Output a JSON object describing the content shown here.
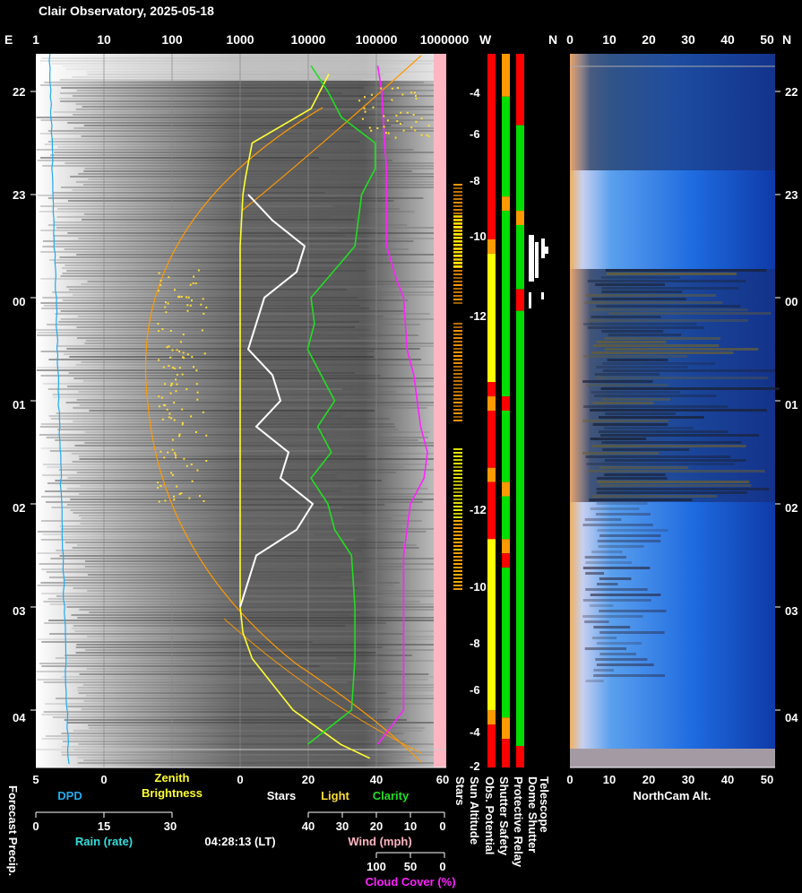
{
  "title": "Clair Observatory, 2025-05-18",
  "timestamp": "04:28:13 (LT)",
  "colors": {
    "sky": "#1e6be0",
    "dpd": "#22aaee",
    "rain": "#33dddd",
    "zenith": "#ffff33",
    "stars": "#ffffff",
    "light": "#ffdd33",
    "clarity": "#22dd22",
    "wind": "#ffb6c1",
    "cloud": "#ff22ff",
    "sun": "#ff9900",
    "status_green": "#00dd00",
    "status_red": "#ff0000",
    "status_orange": "#ff9900",
    "status_yellow": "#ffff00"
  },
  "top_axis": {
    "left_letter": "E",
    "ticks": [
      "1",
      "10",
      "100",
      "1000",
      "10000",
      "100000",
      "1000000"
    ],
    "w_label": "W",
    "n_label": "N",
    "cam_ticks": [
      "0",
      "10",
      "20",
      "30",
      "40",
      "50"
    ],
    "right_letter": "N"
  },
  "time_axis": {
    "left_ticks": [
      "22",
      "23",
      "00",
      "01",
      "02",
      "03",
      "04"
    ],
    "right_ticks": [
      "22",
      "23",
      "00",
      "01",
      "02",
      "03",
      "04"
    ]
  },
  "sun_altitude": {
    "upper_ticks": [
      "-4",
      "-6",
      "-8",
      "-10",
      "-12"
    ],
    "lower_ticks": [
      "-12",
      "-10",
      "-8",
      "-6",
      "-4",
      "-2"
    ]
  },
  "bottom_axes": {
    "dpd_ticks": [
      "5",
      "0"
    ],
    "zenith_label_1": "Zenith",
    "zenith_label_2": "Brightness",
    "main_ticks": [
      "0",
      "20",
      "40",
      "60"
    ],
    "dpd_label": "DPD",
    "stars_label": "Stars",
    "light_label": "Light",
    "clarity_label": "Clarity",
    "rain_ticks": [
      "0",
      "15",
      "30"
    ],
    "rain_label": "Rain (rate)",
    "wind_ticks": [
      "40",
      "30",
      "20",
      "10",
      "0"
    ],
    "wind_label": "Wind (mph)",
    "cloud_ticks": [
      "100",
      "50",
      "0"
    ],
    "cloud_label": "Cloud Cover (%)",
    "cam_ticks": [
      "0",
      "10",
      "20",
      "30",
      "40",
      "50"
    ],
    "cam_label": "NorthCam Alt."
  },
  "vertical_labels": {
    "forecast": "Forecast Precip.",
    "stars": "Stars",
    "sun_altitude": "Sun Altitude",
    "obs_potential": "Obs. Potential",
    "shutter_safety": "Shutter Safety",
    "protective_relay": "Protective Relay",
    "dome_shutter": "Dome Shutter",
    "telescope": "Telescope"
  },
  "chart_data": {
    "type": "line",
    "time_range": [
      "21:45",
      "04:28"
    ],
    "series": [
      {
        "name": "Zenith Brightness",
        "x": [
          "21:50",
          "22:10",
          "22:30",
          "22:50",
          "23:00",
          "23:30",
          "00:00",
          "00:30",
          "01:00",
          "01:30",
          "02:00",
          "02:30",
          "02:50",
          "03:00",
          "03:15",
          "03:30",
          "04:00",
          "04:20",
          "04:28"
        ],
        "values": [
          20000,
          11000,
          1500,
          1200,
          1100,
          1000,
          1000,
          1000,
          1000,
          1000,
          1000,
          1000,
          1000,
          1000,
          1100,
          1500,
          6000,
          30000,
          80000
        ]
      },
      {
        "name": "Stars",
        "x": [
          "23:00",
          "23:15",
          "23:30",
          "23:45",
          "00:00",
          "00:15",
          "00:30",
          "00:45",
          "01:00",
          "01:15",
          "01:30",
          "01:45",
          "02:00",
          "02:15",
          "02:30",
          "02:45",
          "03:00"
        ],
        "values": [
          1,
          4,
          8,
          7,
          3,
          2,
          1,
          4,
          5,
          2,
          6,
          5,
          9,
          7,
          2,
          1,
          0
        ]
      },
      {
        "name": "Clarity",
        "x": [
          "21:45",
          "22:00",
          "22:15",
          "22:30",
          "22:45",
          "23:00",
          "23:30",
          "00:00",
          "00:15",
          "00:30",
          "00:45",
          "01:00",
          "01:15",
          "01:30",
          "01:45",
          "02:00",
          "02:15",
          "02:30",
          "03:00",
          "03:30",
          "04:00",
          "04:20"
        ],
        "values": [
          21,
          26,
          30,
          40,
          40,
          36,
          34,
          21,
          22,
          20,
          24,
          28,
          23,
          27,
          21,
          26,
          28,
          33,
          34,
          34,
          33,
          20
        ]
      },
      {
        "name": "Cloud Cover (%)",
        "x": [
          "21:45",
          "22:00",
          "22:15",
          "22:30",
          "22:45",
          "23:00",
          "23:30",
          "23:50",
          "00:00",
          "00:30",
          "00:45",
          "01:00",
          "01:15",
          "01:30",
          "01:45",
          "02:00",
          "02:30",
          "03:00",
          "03:30",
          "04:00",
          "04:20"
        ],
        "values": [
          98,
          92,
          90,
          88,
          85,
          85,
          85,
          70,
          60,
          55,
          45,
          40,
          35,
          25,
          30,
          50,
          60,
          60,
          60,
          60,
          98
        ]
      }
    ],
    "scales": {
      "brightness": {
        "type": "log",
        "range": [
          1,
          1000000
        ]
      },
      "main_linear": [
        0,
        60
      ],
      "wind_mph": [
        40,
        0
      ],
      "cloud_pct": [
        100,
        0
      ],
      "dpd": [
        5,
        0
      ],
      "rain": [
        0,
        30
      ],
      "cam_alt": [
        0,
        50
      ]
    },
    "status_columns": [
      {
        "name": "Obs. Potential",
        "segments": [
          [
            "red",
            0.0,
            0.26
          ],
          [
            "orange",
            0.26,
            0.28
          ],
          [
            "yellow",
            0.28,
            0.46
          ],
          [
            "red",
            0.46,
            0.48
          ],
          [
            "orange",
            0.48,
            0.5
          ],
          [
            "red",
            0.5,
            0.58
          ],
          [
            "orange",
            0.58,
            0.6
          ],
          [
            "red",
            0.6,
            0.68
          ],
          [
            "yellow",
            0.68,
            0.92
          ],
          [
            "orange",
            0.92,
            0.94
          ],
          [
            "red",
            0.94,
            1.0
          ]
        ]
      },
      {
        "name": "Shutter Safety",
        "segments": [
          [
            "orange",
            0.0,
            0.06
          ],
          [
            "green",
            0.06,
            0.2
          ],
          [
            "orange",
            0.2,
            0.22
          ],
          [
            "green",
            0.22,
            0.48
          ],
          [
            "red",
            0.48,
            0.5
          ],
          [
            "green",
            0.5,
            0.6
          ],
          [
            "orange",
            0.6,
            0.62
          ],
          [
            "green",
            0.62,
            0.68
          ],
          [
            "orange",
            0.68,
            0.7
          ],
          [
            "red",
            0.7,
            0.72
          ],
          [
            "green",
            0.72,
            0.93
          ],
          [
            "orange",
            0.93,
            0.96
          ],
          [
            "red",
            0.96,
            1.0
          ]
        ]
      },
      {
        "name": "Protective Relay",
        "segments": [
          [
            "red",
            0.0,
            0.1
          ],
          [
            "green",
            0.1,
            0.22
          ],
          [
            "orange",
            0.22,
            0.24
          ],
          [
            "green",
            0.24,
            0.33
          ],
          [
            "red",
            0.33,
            0.36
          ],
          [
            "green",
            0.36,
            0.97
          ],
          [
            "red",
            0.97,
            1.0
          ]
        ]
      }
    ]
  }
}
